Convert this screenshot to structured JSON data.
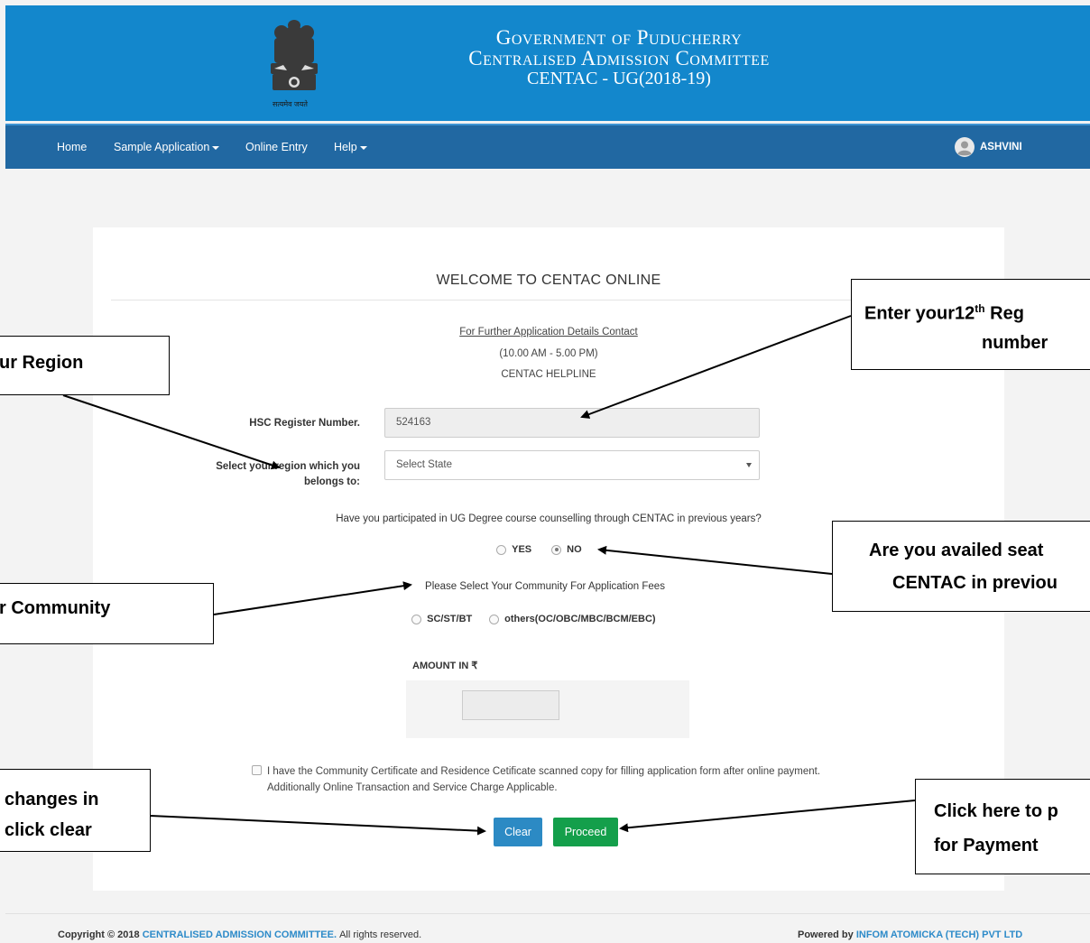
{
  "header": {
    "line1": "Government of Puducherry",
    "line2": "Centralised Admission Committee",
    "line3": "CENTAC - UG(2018-19)",
    "emblem_motto": "सत्यमेव जयते"
  },
  "nav": {
    "home": "Home",
    "sample_application": "Sample Application",
    "online_entry": "Online Entry",
    "help": "Help",
    "user": "ASHVINI"
  },
  "form": {
    "welcome": "WELCOME TO CENTAC ONLINE",
    "contact_link": "For Further Application Details Contact",
    "hours": "(10.00 AM - 5.00 PM)",
    "helpline": "CENTAC HELPLINE",
    "hsc_label": "HSC Register Number.",
    "hsc_value": "524163",
    "region_label_1": "Select your region which you",
    "region_label_2": "belongs to:",
    "region_value": "Select State",
    "prev_question": "Have you participated in UG Degree course counselling through CENTAC in previous years?",
    "yes": "YES",
    "no": "NO",
    "prev_selected": "NO",
    "community_question": "Please Select Your Community For Application Fees",
    "community_opt1": "SC/ST/BT",
    "community_opt2": "others(OC/OBC/MBC/BCM/EBC)",
    "amount_label": "AMOUNT IN ₹",
    "amount_value": "",
    "declaration": "I have the Community Certificate and Residence Cetificate scanned copy for filling application form after online payment. Additionally Online Transaction and Service Charge Applicable.",
    "clear": "Clear",
    "proceed": "Proceed"
  },
  "footer": {
    "copyright_prefix": "Copyright © 2018",
    "copyright_org": "CENTRALISED ADMISSION COMMITTEE.",
    "copyright_suffix": "All rights reserved.",
    "powered_prefix": "Powered by",
    "powered_org": "INFOM ATOMICKA (TECH) PVT LTD"
  },
  "annotations": {
    "region": "ur Region",
    "community": "r Community",
    "clear_1": "changes in",
    "clear_2": "click clear",
    "reg_1": "Enter your12",
    "reg_sup": "th",
    "reg_2": " Reg",
    "reg_3": "number",
    "availed_1": "Are you availed seat",
    "availed_2": "CENTAC in previou",
    "payment_1": "Click here to p",
    "payment_2": "for Payment"
  },
  "colors": {
    "header_bg": "#1387cc",
    "nav_bg": "#2168a2",
    "clear_btn": "#2c8ac4",
    "proceed_btn": "#149f4b",
    "link": "#2e8bc9"
  }
}
